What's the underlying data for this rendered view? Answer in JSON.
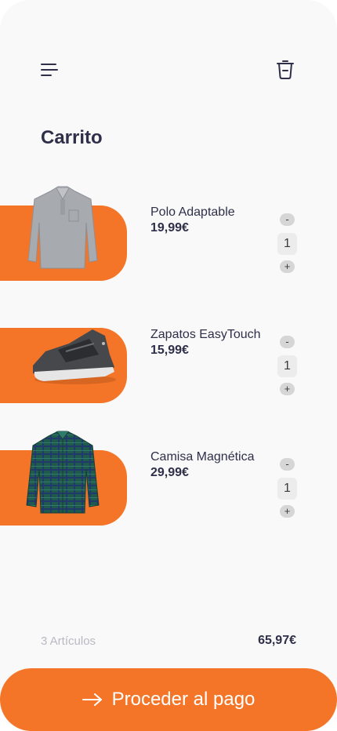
{
  "header": {
    "menu_icon": "hamburger-menu-icon",
    "trash_icon": "trash-icon"
  },
  "page": {
    "title": "Carrito"
  },
  "colors": {
    "accent": "#f47527",
    "background": "#f9f9f9",
    "text": "#2f2f4a",
    "muted": "#b9b9c3"
  },
  "cart": {
    "items": [
      {
        "name": "Polo Adaptable",
        "price": "19,99€",
        "quantity": "1",
        "decrement": "-",
        "increment": "+",
        "image_icon": "polo-shirt-image"
      },
      {
        "name": "Zapatos EasyTouch",
        "price": "15,99€",
        "quantity": "1",
        "decrement": "-",
        "increment": "+",
        "image_icon": "sneaker-image"
      },
      {
        "name": "Camisa Magnética",
        "price": "29,99€",
        "quantity": "1",
        "decrement": "-",
        "increment": "+",
        "image_icon": "plaid-shirt-image"
      }
    ]
  },
  "summary": {
    "count": "3 Artículos",
    "total": "65,97€"
  },
  "checkout": {
    "label": "Proceder al pago",
    "icon": "arrow-right-icon"
  }
}
